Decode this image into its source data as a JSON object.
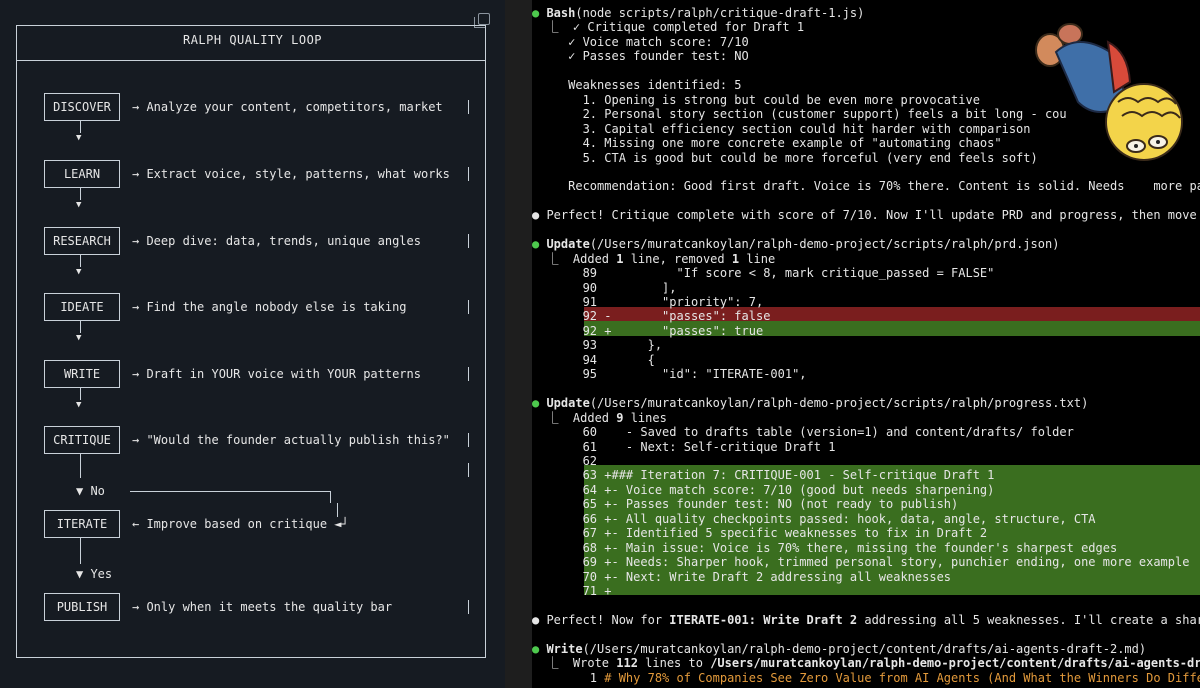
{
  "diagram": {
    "title": "RALPH QUALITY LOOP",
    "steps": [
      {
        "name": "DISCOVER",
        "desc": "→ Analyze your content, competitors, market"
      },
      {
        "name": "LEARN",
        "desc": "→ Extract voice, style, patterns, what works"
      },
      {
        "name": "RESEARCH",
        "desc": "→ Deep dive: data, trends, unique angles"
      },
      {
        "name": "IDEATE",
        "desc": "→ Find the angle nobody else is taking"
      },
      {
        "name": "WRITE",
        "desc": "→ Draft in YOUR voice with YOUR patterns"
      },
      {
        "name": "CRITIQUE",
        "desc": "→ \"Would the founder actually publish this?\""
      },
      {
        "name": "ITERATE",
        "desc": "← Improve based on critique ◄┘"
      },
      {
        "name": "PUBLISH",
        "desc": "→ Only when it meets the quality bar"
      }
    ],
    "no_label": "▼  No",
    "yes_label": "▼  Yes"
  },
  "terminal": {
    "lines": [
      {
        "t": "● ",
        "c": "green",
        "rest": [
          {
            "t": "Bash",
            "b": true
          },
          {
            "t": "(node scripts/ralph/critique-draft-1.js)"
          }
        ]
      },
      {
        "t": "  ⎿  ✓ Critique completed for Draft 1"
      },
      {
        "t": "     ✓ Voice match score: 7/10"
      },
      {
        "t": "     ✓ Passes founder test: NO"
      },
      {
        "t": ""
      },
      {
        "t": "     Weaknesses identified: 5"
      },
      {
        "t": "       1. Opening is strong but could be even more provocative"
      },
      {
        "t": "       2. Personal story section (customer support) feels a bit long - cou"
      },
      {
        "t": "       3. Capital efficiency section could hit harder with comparison"
      },
      {
        "t": "       4. Missing one more concrete example of \"automating chaos\""
      },
      {
        "t": "       5. CTA is good but could be more forceful (very end feels soft)"
      },
      {
        "t": ""
      },
      {
        "t": "     Recommendation: Good first draft. Voice is 70% there. Content is solid. Needs    more pass"
      },
      {
        "t": ""
      },
      {
        "t": "● Perfect! Critique complete with score of 7/10. Now I'll update PRD and progress, then move to"
      },
      {
        "t": ""
      },
      {
        "t": "● ",
        "c": "green",
        "rest": [
          {
            "t": "Update",
            "b": true
          },
          {
            "t": "(/Users/muratcankoylan/ralph-demo-project/scripts/ralph/prd.json)"
          }
        ]
      },
      {
        "t": "  ⎿  Added ",
        "rest": [
          {
            "t": "1",
            "b": true
          },
          {
            "t": " line, removed "
          },
          {
            "t": "1",
            "b": true
          },
          {
            "t": " line"
          }
        ]
      },
      {
        "t": "       89           \"If score < 8, mark critique_passed = FALSE\""
      },
      {
        "t": "       90         ],"
      },
      {
        "t": "       91         \"priority\": 7,"
      },
      {
        "t": "       92 -       \"passes\": false"
      },
      {
        "t": "       92 +       \"passes\": true"
      },
      {
        "t": "       93       },"
      },
      {
        "t": "       94       {"
      },
      {
        "t": "       95         \"id\": \"ITERATE-001\","
      },
      {
        "t": ""
      },
      {
        "t": "● ",
        "c": "green",
        "rest": [
          {
            "t": "Update",
            "b": true
          },
          {
            "t": "(/Users/muratcankoylan/ralph-demo-project/scripts/ralph/progress.txt)"
          }
        ]
      },
      {
        "t": "  ⎿  Added ",
        "rest": [
          {
            "t": "9",
            "b": true
          },
          {
            "t": " lines"
          }
        ]
      },
      {
        "t": "       60    - Saved to drafts table (version=1) and content/drafts/ folder"
      },
      {
        "t": "       61    - Next: Self-critique Draft 1"
      },
      {
        "t": "       62"
      },
      {
        "t": "       63 +### Iteration 7: CRITIQUE-001 - Self-critique Draft 1"
      },
      {
        "t": "       64 +- Voice match score: 7/10 (good but needs sharpening)"
      },
      {
        "t": "       65 +- Passes founder test: NO (not ready to publish)"
      },
      {
        "t": "       66 +- All quality checkpoints passed: hook, data, angle, structure, CTA"
      },
      {
        "t": "       67 +- Identified 5 specific weaknesses to fix in Draft 2"
      },
      {
        "t": "       68 +- Main issue: Voice is 70% there, missing the founder's sharpest edges"
      },
      {
        "t": "       69 +- Needs: Sharper hook, trimmed personal story, punchier ending, one more example"
      },
      {
        "t": "       70 +- Next: Write Draft 2 addressing all weaknesses"
      },
      {
        "t": "       71 +"
      },
      {
        "t": ""
      },
      {
        "t": "● Perfect! Now for ",
        "rest": [
          {
            "t": "ITERATE-001: Write Draft 2",
            "b": true
          },
          {
            "t": " addressing all 5 weaknesses. I'll create a sharper"
          }
        ]
      },
      {
        "t": ""
      },
      {
        "t": "● ",
        "c": "green",
        "rest": [
          {
            "t": "Write",
            "b": true
          },
          {
            "t": "(/Users/muratcankoylan/ralph-demo-project/content/drafts/ai-agents-draft-2.md)"
          }
        ]
      },
      {
        "t": "  ⎿  Wrote ",
        "rest": [
          {
            "t": "112",
            "b": true
          },
          {
            "t": " lines to "
          },
          {
            "t": "/Users/muratcankoylan/ralph-demo-project/content/drafts/ai-agents-draft-",
            "b": true
          }
        ]
      },
      {
        "t": "        1 ",
        "rest": [
          {
            "t": "# Why 78% of Companies See Zero Value from AI Agents (And What the Winners Do Differen",
            "c": "orange"
          }
        ]
      }
    ]
  }
}
